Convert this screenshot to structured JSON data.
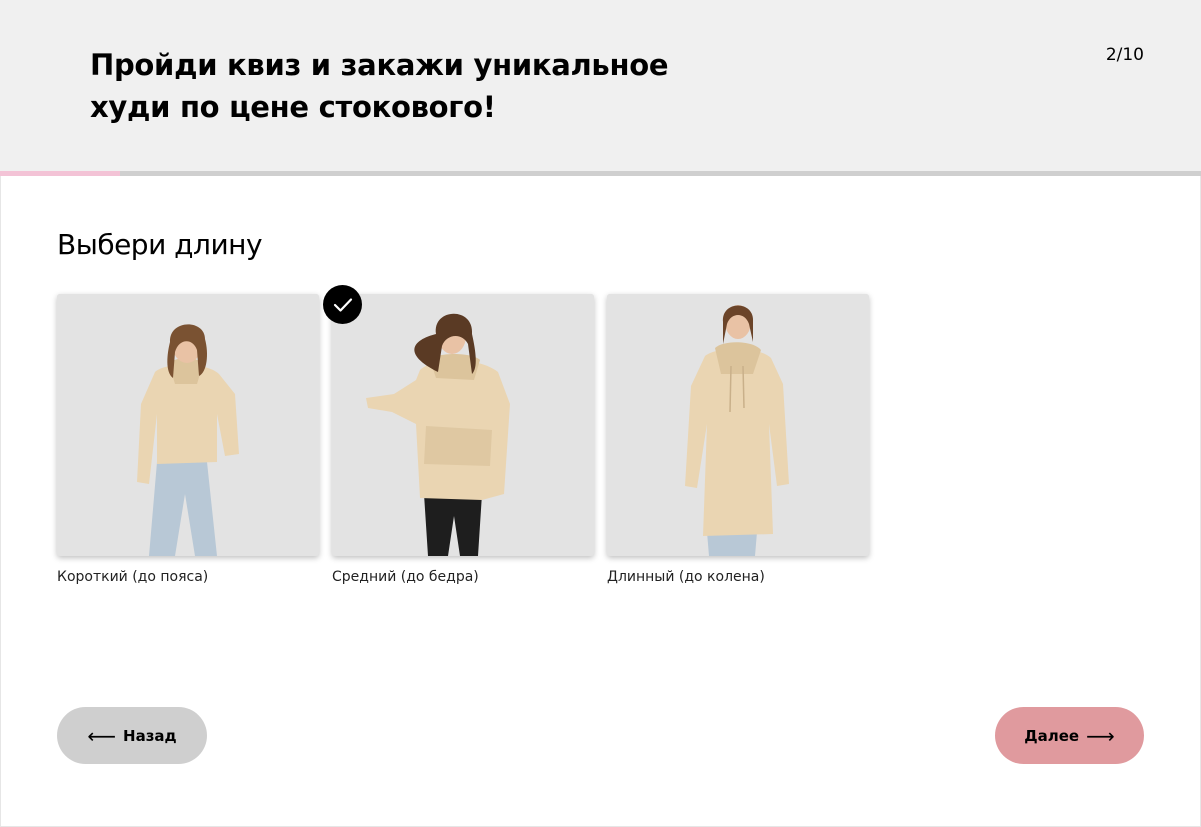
{
  "header": {
    "title_line1": "Пройди квиз и закажи уникальное",
    "title_line2": "худи по цене стокового!",
    "counter": "2/10"
  },
  "progress": {
    "fraction": 0.1,
    "fill_color": "#f3c3d6",
    "track_color": "#cfcfcf"
  },
  "question": "Выбери длину",
  "options": [
    {
      "label": "Короткий (до пояса)",
      "selected": false
    },
    {
      "label": "Средний (до бедра)",
      "selected": true
    },
    {
      "label": "Длинный (до колена)",
      "selected": false
    }
  ],
  "buttons": {
    "back_label": "Назад",
    "back_arrow": "⟵",
    "next_label": "Далее",
    "next_arrow": "⟶"
  },
  "colors": {
    "header_bg": "#f0f0f0",
    "back_button_bg": "#cfcfcf",
    "next_button_bg": "#e09a9e",
    "hoodie": "#ead5b2",
    "photo_bg": "#e2e2e2"
  },
  "icons": {
    "selected_marker": "checkmark-icon"
  }
}
